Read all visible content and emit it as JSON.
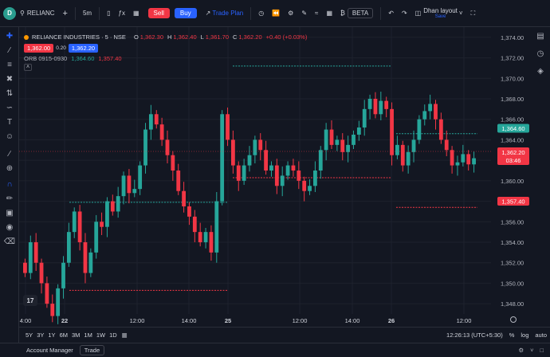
{
  "toolbar": {
    "logo": "D",
    "symbol": "RELIANC",
    "add": "+",
    "interval": "5m",
    "sell": "Sell",
    "buy": "Buy",
    "trade_plan": "Trade Plan",
    "beta": "BETA",
    "layout_title": "Dhan layout",
    "layout_sub": "Save"
  },
  "legend": {
    "title": "RELIANCE INDUSTRIES · 5 · NSE",
    "ohlc": {
      "O": "1,362.30",
      "H": "1,362.40",
      "L": "1,361.70",
      "C": "1,362.20",
      "change": "+0.40 (+0.03%)"
    },
    "bid": "1,362.00",
    "spread": "0.20",
    "ask": "1,362.20",
    "indicator_name": "ORB 0915-0930",
    "indicator_high": "1,364.60",
    "indicator_low": "1,357.40"
  },
  "price_axis": {
    "ticks": [
      "1,374.00",
      "1,372.00",
      "1,370.00",
      "1,368.00",
      "1,366.00",
      "1,364.00",
      "1,362.00",
      "1,360.00",
      "1,358.00",
      "1,356.00",
      "1,354.00",
      "1,352.00",
      "1,350.00",
      "1,348.00"
    ],
    "last_price": "1,362.20",
    "countdown": "03:46",
    "orb_high_label": "1,364.60",
    "orb_low_label": "1,357.40"
  },
  "time_axis": {
    "labels": [
      "4:00",
      "22",
      "12:00",
      "14:00",
      "25",
      "12:00",
      "14:00",
      "26",
      "12:00"
    ]
  },
  "bottombar": {
    "ranges": [
      "5Y",
      "3Y",
      "1Y",
      "6M",
      "3M",
      "1M",
      "1W",
      "1D"
    ],
    "clock": "12:26:13 (UTC+5:30)",
    "percent": "%",
    "log": "log",
    "auto": "auto"
  },
  "footer": {
    "account_manager": "Account Manager",
    "trade": "Trade"
  },
  "colors": {
    "up": "#26a69a",
    "down": "#f23645",
    "accent": "#2962ff",
    "background": "#131722"
  },
  "chart_data": {
    "type": "candlestick",
    "ylim": [
      1347,
      1375
    ],
    "x_labels": [
      "4:00",
      "22",
      "12:00",
      "14:00",
      "25",
      "12:00",
      "14:00",
      "26",
      "12:00"
    ],
    "orb_levels": [
      {
        "session": "22",
        "high": 1357.9,
        "low": 1349.3
      },
      {
        "session": "25",
        "high": 1371.2,
        "low": 1360.3
      },
      {
        "session": "26",
        "high": 1364.6,
        "low": 1357.4
      }
    ],
    "candles_close": [
      1351,
      1354,
      1352,
      1350,
      1348,
      1346.8,
      1349.5,
      1352,
      1355,
      1357,
      1354,
      1351,
      1353,
      1356,
      1355.5,
      1358,
      1357,
      1358.5,
      1360.5,
      1358.8,
      1359.2,
      1361.5,
      1365,
      1366.5,
      1365.5,
      1364,
      1362.5,
      1361,
      1359,
      1357.5,
      1356.5,
      1355,
      1354,
      1355,
      1353,
      1358,
      1366.5,
      1364,
      1361.5,
      1360,
      1361.5,
      1362.5,
      1364,
      1363,
      1361,
      1361.5,
      1359.5,
      1360.5,
      1361.5,
      1361,
      1360,
      1359,
      1359.5,
      1361,
      1363,
      1365,
      1363.5,
      1364,
      1362.8,
      1363.5,
      1364.5,
      1365.2,
      1367,
      1368,
      1366.5,
      1367.8,
      1367,
      1362.5,
      1363.5,
      1361.5,
      1362.8,
      1364,
      1366,
      1366.8,
      1367.5,
      1366,
      1364,
      1363,
      1361.5,
      1361.8,
      1362.6,
      1361.6,
      1362.2
    ]
  }
}
